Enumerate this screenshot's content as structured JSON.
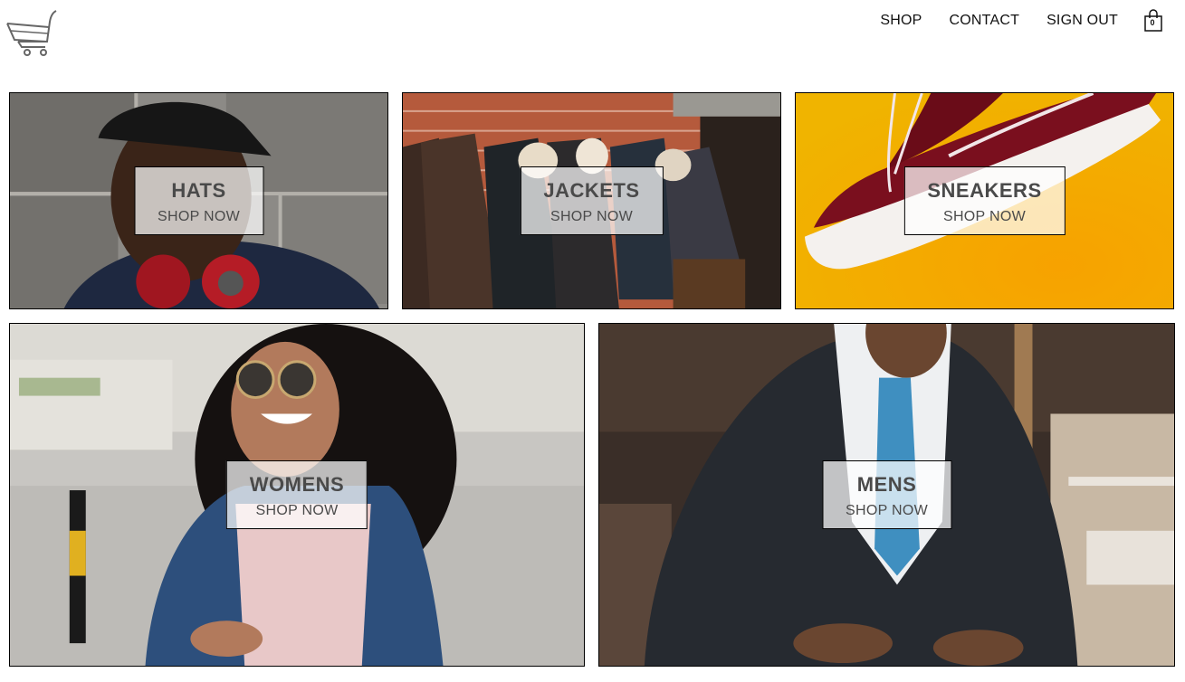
{
  "header": {
    "logo_icon": "shopping-cart-logo-icon",
    "nav": {
      "shop_label": "SHOP",
      "contact_label": "CONTACT",
      "signout_label": "SIGN OUT"
    },
    "cart": {
      "icon": "shopping-bag-icon",
      "count": "0"
    }
  },
  "directory": {
    "sub_label": "SHOP NOW",
    "items": [
      {
        "title": "HATS"
      },
      {
        "title": "JACKETS"
      },
      {
        "title": "SNEAKERS"
      },
      {
        "title": "WOMENS"
      },
      {
        "title": "MENS"
      }
    ]
  },
  "colors": {
    "sneakers_bg": "#f5a800",
    "sneaker_body": "#7a0f1e",
    "denim": "#2d4f7c",
    "tie": "#3f8fc0"
  }
}
